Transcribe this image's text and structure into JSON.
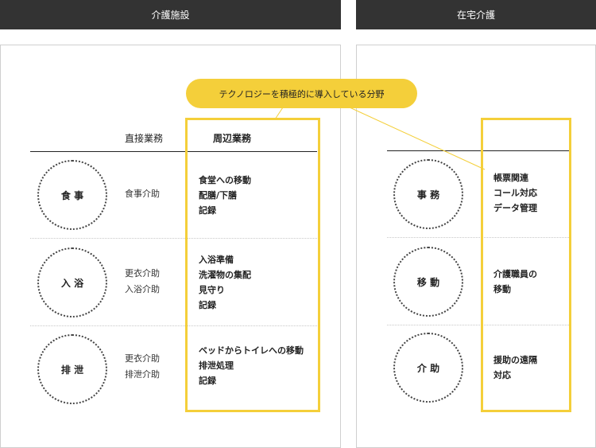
{
  "headers": {
    "facility": "介護施設",
    "home": "在宅介護"
  },
  "callout": "テクノロジーを積極的に導入している分野",
  "facility": {
    "col_direct": "直接業務",
    "col_peripheral": "周辺業務",
    "rows": [
      {
        "circle": "食 事",
        "direct": [
          "食事介助"
        ],
        "peripheral": [
          "食堂への移動",
          "配膳/下膳",
          "記録"
        ]
      },
      {
        "circle": "入 浴",
        "direct": [
          "更衣介助",
          "入浴介助"
        ],
        "peripheral": [
          "入浴準備",
          "洗濯物の集配",
          "見守り",
          "記録"
        ]
      },
      {
        "circle": "排 泄",
        "direct": [
          "更衣介助",
          "排泄介助"
        ],
        "peripheral": [
          "ベッドからトイレへの移動",
          "排泄処理",
          "記録"
        ]
      }
    ]
  },
  "home": {
    "rows": [
      {
        "circle": "事 務",
        "peripheral": [
          "帳票関連",
          "コール対応",
          "データ管理"
        ]
      },
      {
        "circle": "移 動",
        "peripheral": [
          "介護職員の",
          "移動"
        ]
      },
      {
        "circle": "介 助",
        "peripheral": [
          "援助の遠隔",
          "対応"
        ]
      }
    ]
  },
  "colors": {
    "accent": "#f4cf3a",
    "header_bg": "#333333"
  }
}
